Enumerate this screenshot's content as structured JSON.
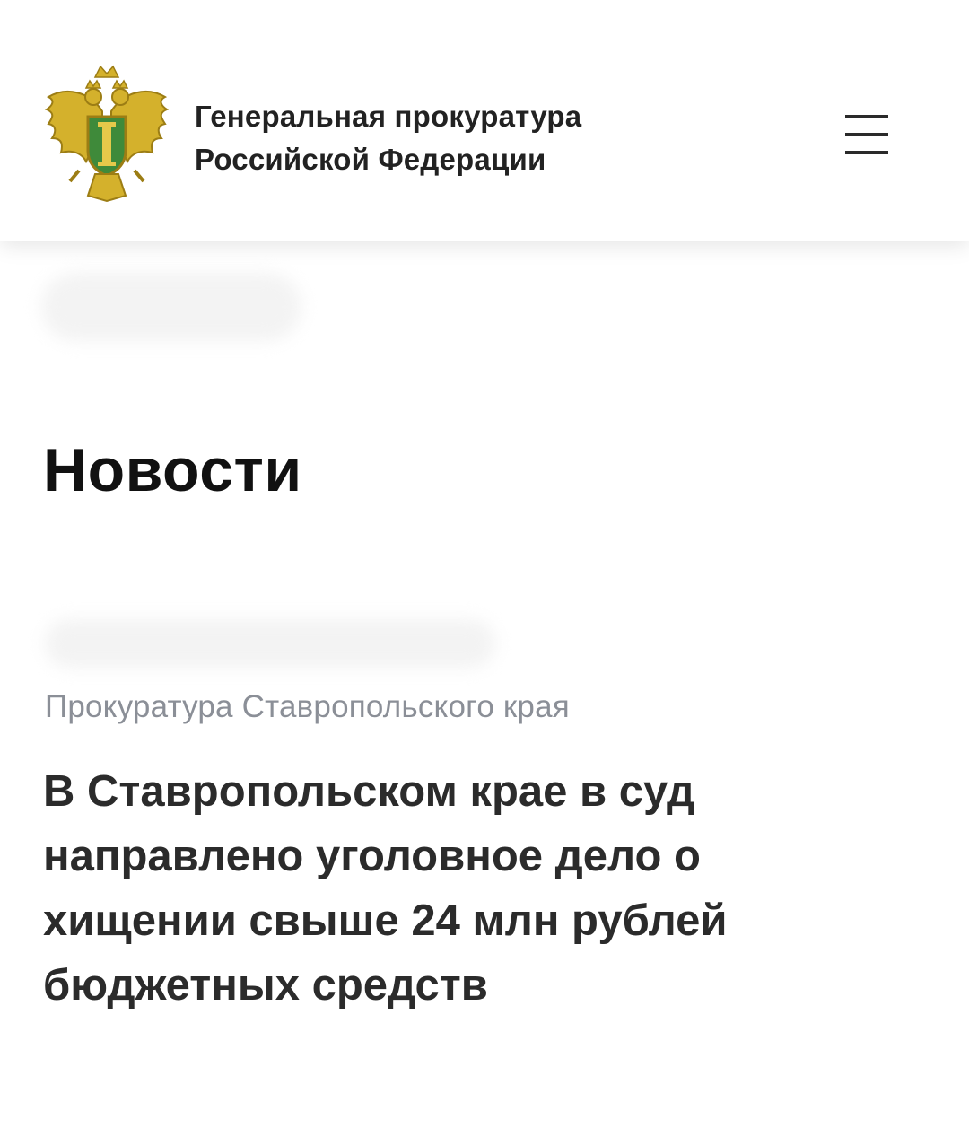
{
  "header": {
    "org_name_line1": "Генеральная прокуратура",
    "org_name_line2": "Российской Федерации",
    "emblem_icon": "eagle-emblem-icon",
    "menu_icon": "hamburger-menu-icon"
  },
  "page": {
    "title": "Новости"
  },
  "news_item": {
    "source": "Прокуратура Ставропольского края",
    "headline": "В Ставропольском крае в суд направлено уголовное дело о хищении свыше 24 млн рублей бюджетных средств"
  },
  "colors": {
    "emblem_gold": "#c9a227",
    "shield_green": "#3f8a3a",
    "source_gray": "#8b8f97"
  }
}
